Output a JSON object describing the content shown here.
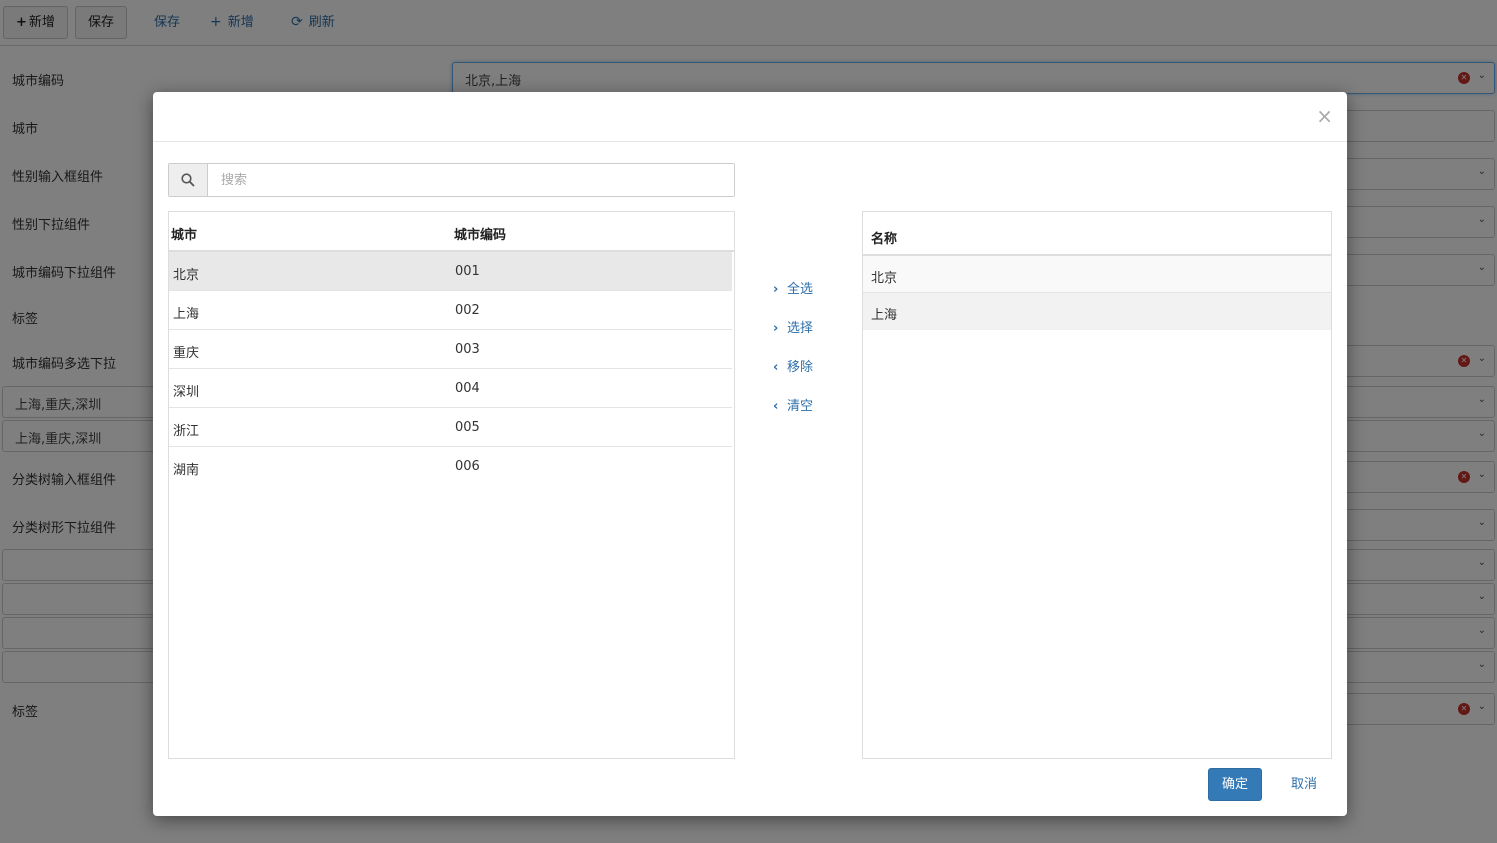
{
  "toolbar": {
    "add_button": "新增",
    "save_button": "保存",
    "save_link": "保存",
    "add_link": "新增",
    "refresh_link": "刷新"
  },
  "form": {
    "city_code_label": "城市编码",
    "city_code_value": "北京,上海",
    "city_label": "城市",
    "gender_input_label": "性别输入框组件",
    "gender_select_label": "性别下拉组件",
    "city_code_select_label": "城市编码下拉组件",
    "tag_label": "标签",
    "city_code_multi_label": "城市编码多选下拉",
    "multi_value_1": "上海,重庆,深圳",
    "multi_value_2": "上海,重庆,深圳",
    "tree_input_label": "分类树输入框组件",
    "tree_select_label": "分类树形下拉组件",
    "tag_label_2": "标签"
  },
  "modal": {
    "close_glyph": "×",
    "search_placeholder": "搜索",
    "left_table": {
      "col_city": "城市",
      "col_code": "城市编码",
      "rows": [
        {
          "city": "北京",
          "code": "001"
        },
        {
          "city": "上海",
          "code": "002"
        },
        {
          "city": "重庆",
          "code": "003"
        },
        {
          "city": "深圳",
          "code": "004"
        },
        {
          "city": "浙江",
          "code": "005"
        },
        {
          "city": "湖南",
          "code": "006"
        }
      ]
    },
    "transfer": {
      "select_all": "全选",
      "select": "选择",
      "remove": "移除",
      "clear": "清空"
    },
    "right_table": {
      "col_name": "名称",
      "rows": [
        {
          "name": "北京"
        },
        {
          "name": "上海"
        }
      ]
    },
    "ok_button": "确定",
    "cancel_button": "取消"
  },
  "colors": {
    "primary": "#337ab7",
    "link": "#2f6fab",
    "clear_icon": "#c9302c"
  }
}
